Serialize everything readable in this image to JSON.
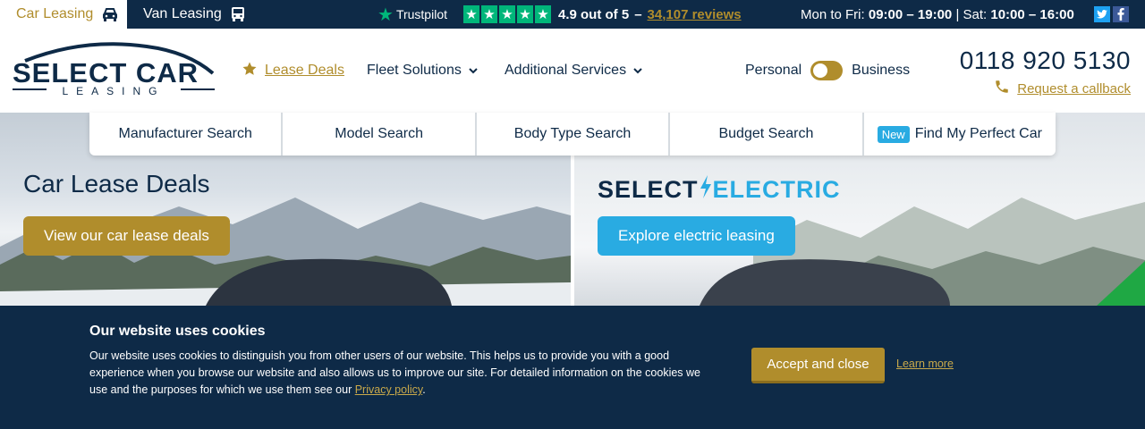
{
  "topbar": {
    "car_tab": "Car Leasing",
    "van_tab": "Van Leasing",
    "trustpilot_label": "Trustpilot",
    "rating_text": "4.9 out of 5",
    "dash": "–",
    "reviews_link": "34,107 reviews",
    "hours_weekday_label": "Mon to Fri:",
    "hours_weekday": "09:00 – 19:00",
    "hours_sep": "|",
    "hours_sat_label": "Sat:",
    "hours_sat": "10:00 – 16:00"
  },
  "header": {
    "logo_main": "SELECT CAR",
    "logo_sub": "LEASING",
    "nav_lease": "Lease Deals",
    "nav_fleet": "Fleet Solutions",
    "nav_additional": "Additional Services",
    "toggle_personal": "Personal",
    "toggle_business": "Business",
    "phone": "0118 920 5130",
    "callback": "Request a callback"
  },
  "search_tabs": {
    "manufacturer": "Manufacturer Search",
    "model": "Model Search",
    "body_type": "Body Type Search",
    "budget": "Budget Search",
    "new_badge": "New",
    "perfect_car": "Find My Perfect Car"
  },
  "hero": {
    "left_title": "Car Lease Deals",
    "left_button": "View our car lease deals",
    "right_logo_a": "SELECT",
    "right_logo_b": "ELECTRIC",
    "right_button": "Explore electric leasing"
  },
  "cookie": {
    "title": "Our website uses cookies",
    "body": "Our website uses cookies to distinguish you from other users of our website. This helps us to provide you with a good experience when you browse our website and also allows us to improve our site. For detailed information on the cookies we use and the purposes for which we use them see our",
    "privacy_link": "Privacy policy",
    "period": ".",
    "accept_button": "Accept and close",
    "learn_more": "Learn more"
  },
  "colors": {
    "navy": "#0e2a47",
    "gold": "#b08d2c",
    "electric_blue": "#29abe2",
    "trustpilot_green": "#00b67a"
  }
}
